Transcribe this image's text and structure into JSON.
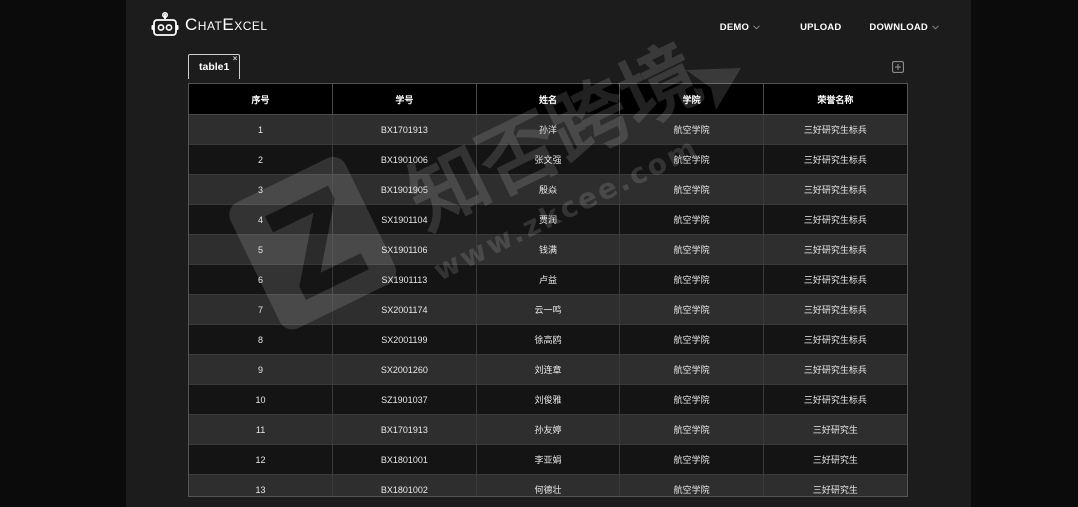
{
  "app": {
    "logo_text": "ChatExcel",
    "logo_icon": "robot-icon"
  },
  "nav": {
    "demo": "DEMO",
    "upload": "UPLOAD",
    "download": "DOWNLOAD"
  },
  "tabs": [
    {
      "label": "table1",
      "close": "×"
    }
  ],
  "table": {
    "headers": [
      "序号",
      "学号",
      "姓名",
      "学院",
      "荣誉名称"
    ],
    "rows": [
      [
        "1",
        "BX1701913",
        "孙洋",
        "航空学院",
        "三好研究生标兵"
      ],
      [
        "2",
        "BX1901006",
        "张文强",
        "航空学院",
        "三好研究生标兵"
      ],
      [
        "3",
        "BX1901905",
        "殷焱",
        "航空学院",
        "三好研究生标兵"
      ],
      [
        "4",
        "SX1901104",
        "贾润",
        "航空学院",
        "三好研究生标兵"
      ],
      [
        "5",
        "SX1901106",
        "钱满",
        "航空学院",
        "三好研究生标兵"
      ],
      [
        "6",
        "SX1901113",
        "卢益",
        "航空学院",
        "三好研究生标兵"
      ],
      [
        "7",
        "SX2001174",
        "云一鸣",
        "航空学院",
        "三好研究生标兵"
      ],
      [
        "8",
        "SX2001199",
        "徐高鸥",
        "航空学院",
        "三好研究生标兵"
      ],
      [
        "9",
        "SX2001260",
        "刘连章",
        "航空学院",
        "三好研究生标兵"
      ],
      [
        "10",
        "SZ1901037",
        "刘俊雅",
        "航空学院",
        "三好研究生标兵"
      ],
      [
        "11",
        "BX1701913",
        "孙友婷",
        "航空学院",
        "三好研究生"
      ],
      [
        "12",
        "BX1801001",
        "李亚娟",
        "航空学院",
        "三好研究生"
      ],
      [
        "13",
        "BX1801002",
        "何德壮",
        "航空学院",
        "三好研究生"
      ]
    ]
  },
  "watermark": {
    "text": "知否跨境",
    "url": "www.zkcee.com"
  },
  "colors": {
    "background": "#1c1c1c",
    "header_row": "#000000",
    "row_odd": "#2e2e2e",
    "row_even": "#141414",
    "text": "#e8e8e8"
  }
}
